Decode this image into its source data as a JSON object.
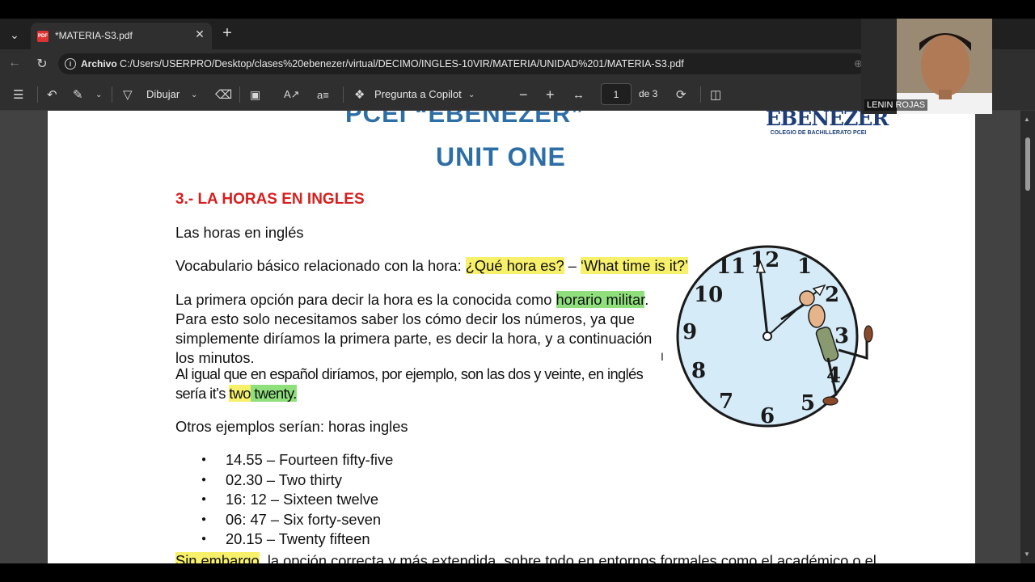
{
  "browser": {
    "tab": {
      "title": "*MATERIA-S3.pdf",
      "icon": "pdf-icon"
    },
    "address": {
      "label": "Archivo",
      "url": "C:/Users/USERPRO/Desktop/clases%20ebenezer/virtual/DECIMO/INGLES-10VIR/MATERIA/UNIDAD%201/MATERIA-S3.pdf"
    }
  },
  "toolbar": {
    "draw_label": "Dibujar",
    "copilot_label": "Pregunta a Copilot",
    "page_current": "1",
    "page_total_label": "de 3"
  },
  "webcam": {
    "name": "LENIN ROJAS"
  },
  "document": {
    "school_title": "PCEI “EBENEZER”",
    "unit_title": "UNIT ONE",
    "logo": {
      "main": "EBENEZER",
      "sub": "COLEGIO DE BACHILLERATO PCEI"
    },
    "section_heading": "3.- LA HORAS  EN INGLES",
    "p1": "Las horas en inglés",
    "p2": {
      "before": "Vocabulario básico relacionado con la hora: ",
      "hl1": "¿Qué hora es?",
      "mid": " – ",
      "hl2": "‘What time is it?’"
    },
    "p3": {
      "before": "La primera opción para decir la hora es la conocida como ",
      "hl": "horario militar",
      "after": ". Para esto solo necesitamos saber los cómo decir los números, ya que simplemente diríamos la primera parte, es decir la hora, y a continuación los minutos."
    },
    "p4": {
      "before": "Al igual que en español diríamos, por ejemplo, son las dos y veinte, en inglés sería it’s ",
      "hl_y": "two",
      "space": " ",
      "hl_g": "twenty."
    },
    "p5": "Otros ejemplos serían: horas ingles",
    "examples": [
      "14.55 – Fourteen fifty-five",
      "02.30 – Two thirty",
      "16: 12 – Sixteen twelve",
      "06: 47 – Six forty-seven",
      "20.15 – Twenty fifteen"
    ],
    "cut_line": {
      "hl": "Sin embargo",
      "rest": ", la opción correcta y más extendida, sobre todo en entornos formales como el académico o el"
    },
    "clock_numbers": [
      "12",
      "1",
      "2",
      "3",
      "4",
      "5",
      "6",
      "7",
      "8",
      "9",
      "10",
      "11"
    ]
  }
}
